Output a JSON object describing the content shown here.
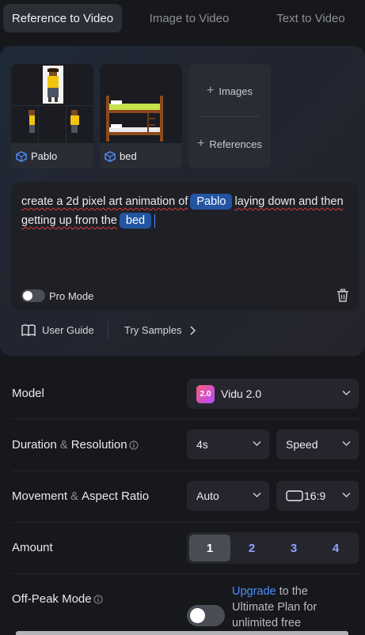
{
  "tabs": [
    {
      "label": "Reference to Video",
      "active": true
    },
    {
      "label": "Image to Video",
      "active": false
    },
    {
      "label": "Text to Video",
      "active": false
    }
  ],
  "references": [
    {
      "label": "Pablo",
      "icon": "cube-icon"
    },
    {
      "label": "bed",
      "icon": "cube-icon"
    }
  ],
  "add_card": {
    "images_label": "Images",
    "references_label": "References"
  },
  "prompt": {
    "part1": "create a 2d pixel art animation of",
    "tag1": "Pablo",
    "part2": "laying down and then getting up from the",
    "tag2": "bed"
  },
  "pro_mode": {
    "label": "Pro Mode",
    "enabled": false
  },
  "links": {
    "user_guide": "User Guide",
    "try_samples": "Try Samples"
  },
  "settings": {
    "model": {
      "label": "Model",
      "badge": "2.0",
      "value": "Vidu 2.0"
    },
    "duration": {
      "label_a": "Duration",
      "amp": "&",
      "label_b": "Resolution",
      "duration_value": "4s",
      "resolution_value": "Speed"
    },
    "movement": {
      "label_a": "Movement",
      "amp": "&",
      "label_b": "Aspect Ratio",
      "movement_value": "Auto",
      "aspect_value": "16:9"
    },
    "amount": {
      "label": "Amount",
      "options": [
        "1",
        "2",
        "3",
        "4"
      ],
      "selected": "1"
    },
    "off_peak": {
      "label": "Off-Peak Mode",
      "enabled": false,
      "upgrade_link": "Upgrade",
      "upgrade_text": " to the Ultimate Plan for unlimited free"
    }
  },
  "colors": {
    "accent_blue": "#4c8dff",
    "tag_blue": "#2355a3",
    "background": "#17181c"
  }
}
